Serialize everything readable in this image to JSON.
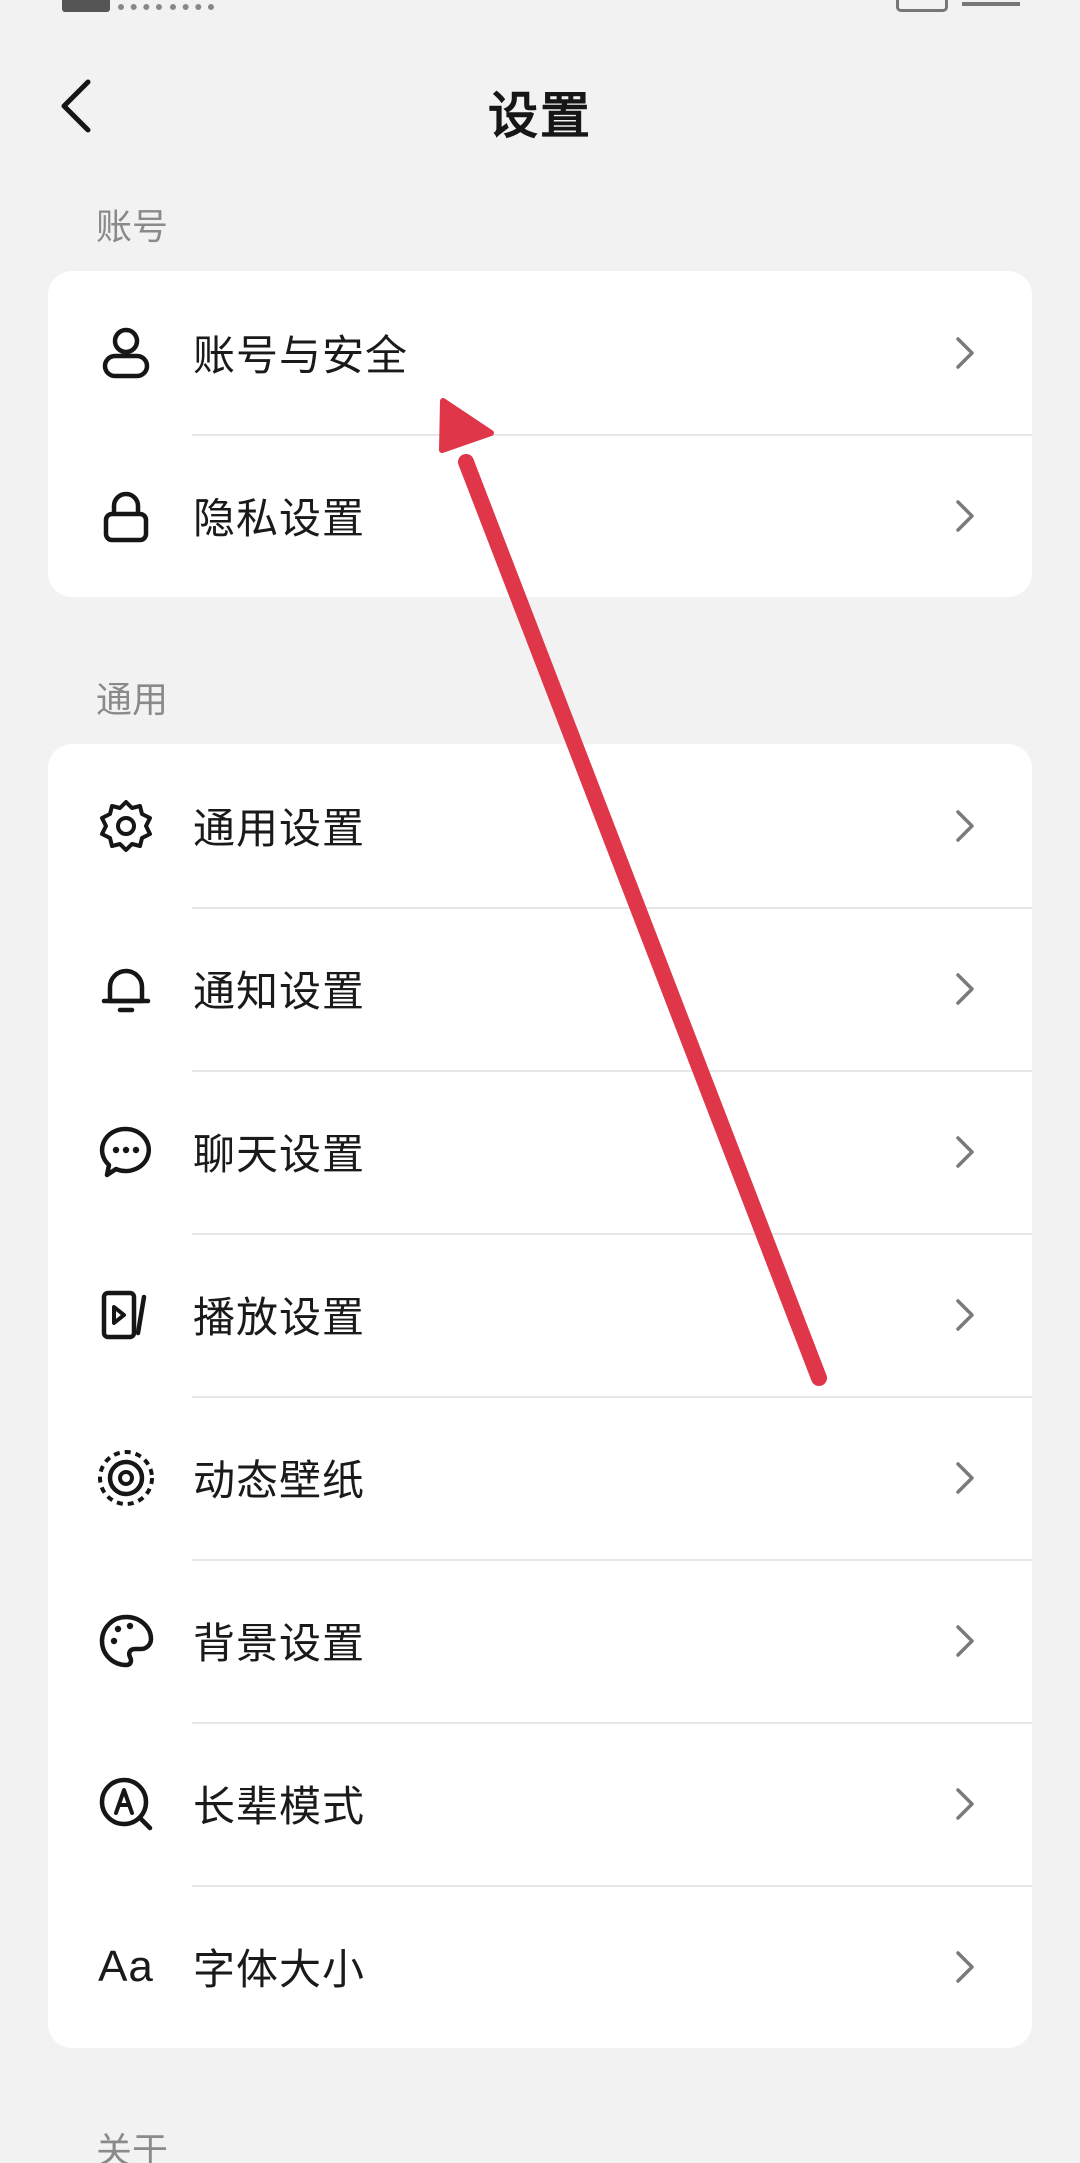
{
  "header": {
    "title": "设置",
    "back_icon": "chevron-left-icon"
  },
  "sections": {
    "account": {
      "label": "账号",
      "items": [
        {
          "label": "账号与安全",
          "icon": "user-icon"
        },
        {
          "label": "隐私设置",
          "icon": "lock-icon"
        }
      ]
    },
    "general": {
      "label": "通用",
      "items": [
        {
          "label": "通用设置",
          "icon": "gear-icon"
        },
        {
          "label": "通知设置",
          "icon": "bell-icon"
        },
        {
          "label": "聊天设置",
          "icon": "chat-bubble-icon"
        },
        {
          "label": "播放设置",
          "icon": "play-screen-icon"
        },
        {
          "label": "动态壁纸",
          "icon": "live-wallpaper-icon"
        },
        {
          "label": "背景设置",
          "icon": "palette-icon"
        },
        {
          "label": "长辈模式",
          "icon": "elder-mode-icon"
        },
        {
          "label": "字体大小",
          "icon": "font-size-icon",
          "icon_text": "Aa"
        }
      ]
    },
    "about": {
      "label": "关于"
    }
  },
  "annotation": {
    "color": "#e0364a",
    "icon": "red-arrow-annotation"
  }
}
